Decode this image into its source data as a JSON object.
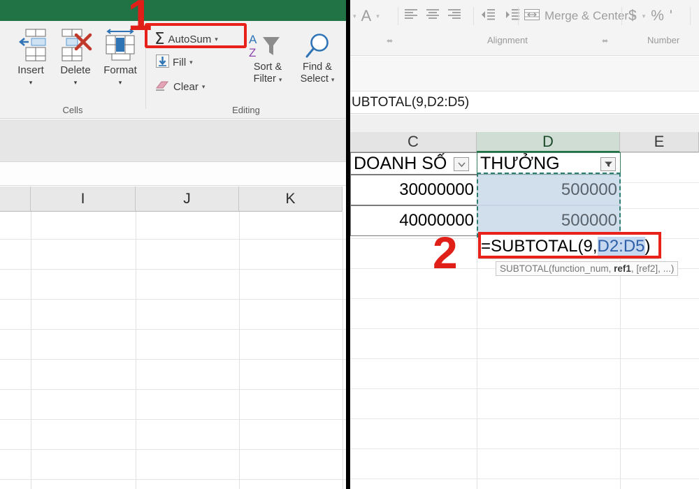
{
  "colors": {
    "excel_green": "#217346",
    "annotation_red": "#e01f18",
    "selection_blue": "#c5d8ef",
    "marching_ants": "#2f7d6e"
  },
  "left_panel": {
    "ribbon": {
      "cells_group": {
        "label": "Cells",
        "buttons": [
          {
            "caption": "Insert",
            "icon": "insert-cells-icon",
            "caret": "▾"
          },
          {
            "caption": "Delete",
            "icon": "delete-cells-icon",
            "caret": "▾"
          },
          {
            "caption": "Format",
            "icon": "format-cells-icon",
            "caret": "▾"
          }
        ]
      },
      "editing_group": {
        "label": "Editing",
        "autosum": {
          "label": "AutoSum",
          "icon": "sigma-icon",
          "caret": "▾"
        },
        "fill": {
          "label": "Fill",
          "icon": "fill-down-icon",
          "caret": "▾"
        },
        "clear": {
          "label": "Clear",
          "icon": "eraser-icon",
          "caret": "▾"
        },
        "sort_filter": {
          "line1": "Sort &",
          "line2": "Filter",
          "icon": "sort-az-filter-icon",
          "caret": "▾"
        },
        "find_select": {
          "line1": "Find &",
          "line2": "Select",
          "icon": "magnifier-icon",
          "caret": "▾"
        }
      }
    },
    "grid": {
      "column_headers": [
        "I",
        "J",
        "K"
      ]
    }
  },
  "annotations": [
    {
      "number": "1",
      "target": "autosum-button"
    },
    {
      "number": "2",
      "target": "formula-entry-cell"
    }
  ],
  "right_panel": {
    "ribbon": {
      "font_fragment": {
        "font_color_letter": "A",
        "caret": "▾"
      },
      "alignment_group": {
        "label": "Alignment",
        "buttons": [
          "align-left-icon",
          "align-center-icon",
          "align-right-icon",
          "decrease-indent-icon",
          "increase-indent-icon"
        ],
        "merge_center": {
          "label": "Merge & Center",
          "icon": "merge-center-icon",
          "caret": "▾"
        },
        "dialog_launcher": "⬌"
      },
      "number_group": {
        "label": "Number",
        "currency": {
          "symbol": "$",
          "caret": "▾"
        },
        "percent": "%",
        "comma": "'"
      }
    },
    "formula_bar": {
      "value": "UBTOTAL(9,D2:D5)"
    },
    "grid": {
      "column_headers": [
        {
          "label": "C",
          "selected": false
        },
        {
          "label": "D",
          "selected": true
        },
        {
          "label": "E",
          "selected": false
        }
      ],
      "header_row": [
        {
          "col": "C",
          "text": "DOANH SỐ",
          "filter_icon": "chevron-down-icon"
        },
        {
          "col": "D",
          "text": "THƯỞNG",
          "filter_icon": "filter-applied-icon"
        }
      ],
      "data_rows": [
        {
          "C": "30000000",
          "D": "500000"
        },
        {
          "C": "40000000",
          "D": "500000"
        }
      ],
      "entry_cell": {
        "prefix": "=SUBTOTAL(9,",
        "reference": "D2:D5",
        "suffix": ")"
      },
      "tooltip": {
        "fn": "SUBTOTAL(function_num, ",
        "bold": "ref1",
        "rest": ", [ref2], ...)"
      }
    }
  }
}
